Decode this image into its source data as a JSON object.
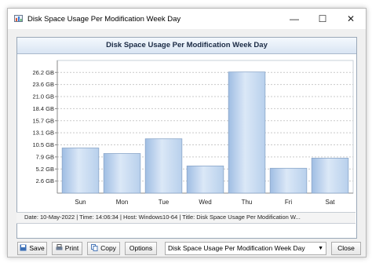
{
  "window": {
    "title": "Disk Space Usage Per Modification Week Day",
    "controls": {
      "minimize": "—",
      "maximize": "☐",
      "close": "✕"
    }
  },
  "chart_header": "Disk Space Usage Per Modification Week Day",
  "chart_data": {
    "type": "bar",
    "title": "Disk Space Usage Per Modification Week Day",
    "categories": [
      "Sun",
      "Mon",
      "Tue",
      "Wed",
      "Thu",
      "Fri",
      "Sat"
    ],
    "values": [
      9.8,
      8.6,
      11.8,
      5.9,
      26.3,
      5.4,
      7.6
    ],
    "unit": "GB",
    "y_ticks": [
      "2.6 GB",
      "5.2 GB",
      "7.9 GB",
      "10.5 GB",
      "13.1 GB",
      "15.7 GB",
      "18.4 GB",
      "21.0 GB",
      "23.6 GB",
      "26.2 GB"
    ],
    "y_tick_values": [
      2.62,
      5.24,
      7.86,
      10.48,
      13.1,
      15.72,
      18.34,
      20.96,
      23.58,
      26.2
    ],
    "ylim": [
      0,
      28.8
    ],
    "grid": true,
    "bar_color": "#b8d0ec"
  },
  "status_bar": "Date: 10-May-2022 | Time: 14:06:34 | Host: Windows10-64 | Title: Disk Space Usage Per Modification W...",
  "buttons": {
    "save": "Save",
    "print": "Print",
    "copy": "Copy",
    "options": "Options",
    "close": "Close"
  },
  "chart_selector": {
    "value": "Disk Space Usage Per Modification Week Day"
  }
}
